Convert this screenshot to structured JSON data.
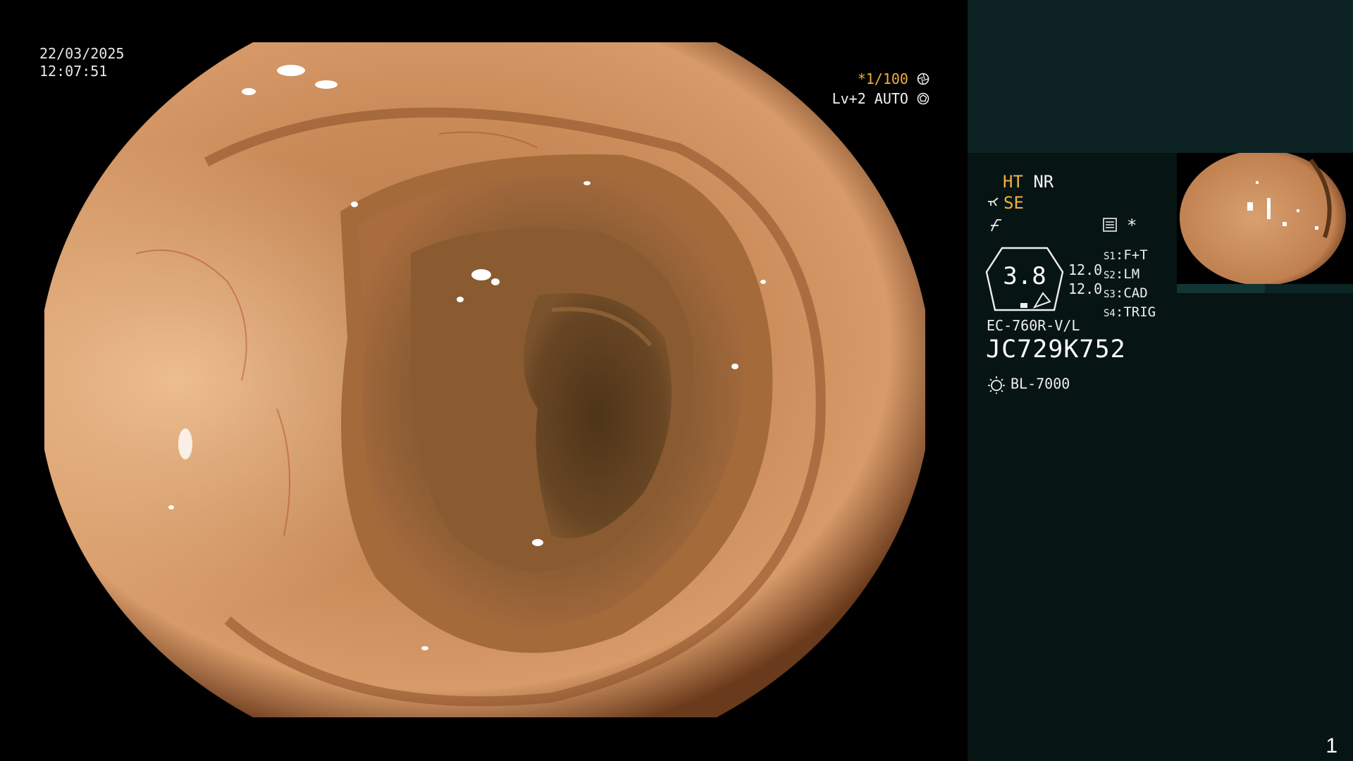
{
  "overlay": {
    "date": "22/03/2025",
    "time": "12:07:51",
    "shutter_speed": "*1/100",
    "shutter_icon": "shutter-icon",
    "level": "Lv+2 AUTO",
    "level_icon": "iris-icon"
  },
  "panel": {
    "modes": {
      "ht": "HT",
      "nr": "NR",
      "se": "SE",
      "se_icon": "structure-enhance-icon",
      "color_icon": "color-mode-icon",
      "record_icon": "record-icon",
      "star": "*"
    },
    "zoom": {
      "value": "3.8",
      "value_a": "12.0",
      "value_b": "12.0"
    },
    "switches": [
      {
        "key": "S1",
        "label": "F+T"
      },
      {
        "key": "S2",
        "label": "LM"
      },
      {
        "key": "S3",
        "label": "CAD"
      },
      {
        "key": "S4",
        "label": "TRIG"
      }
    ],
    "scope_model": "EC-760R-V/L",
    "serial": "JC729K752",
    "light_source": "BL-7000",
    "light_icon": "light-source-icon",
    "page_number": "1"
  },
  "colors": {
    "accent": "#f0b040",
    "panel_bg": "#071414",
    "panel_top_bg": "#0d2222"
  }
}
